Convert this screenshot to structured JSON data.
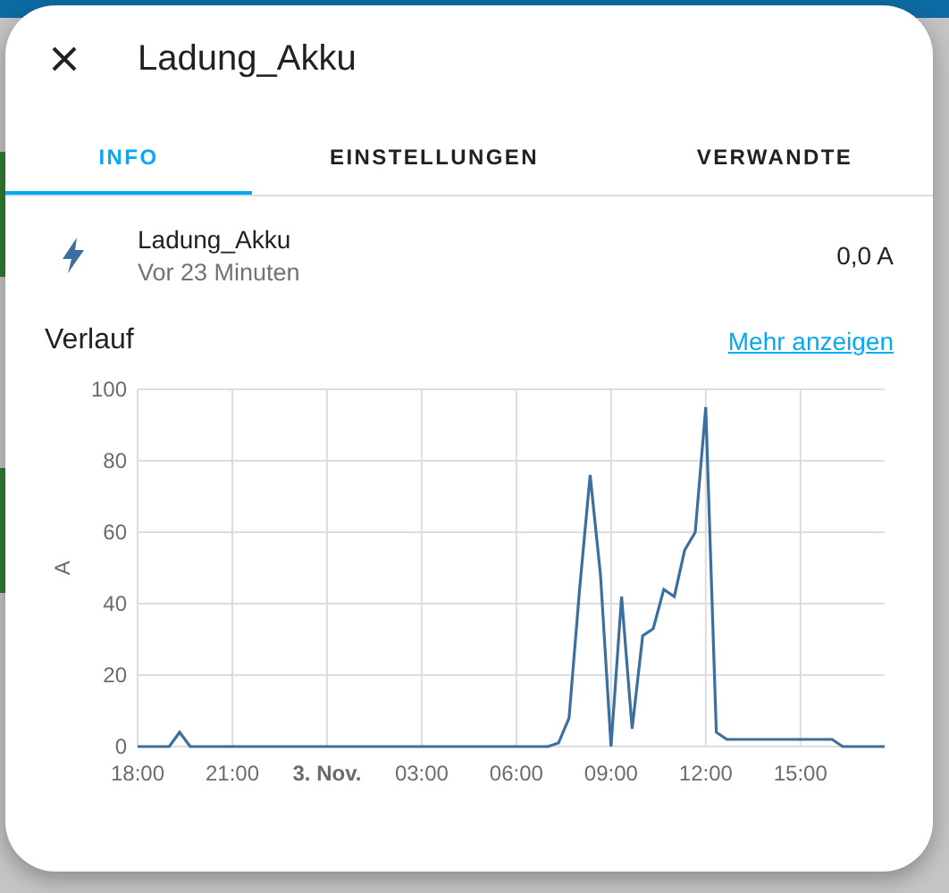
{
  "dialog": {
    "title": "Ladung_Akku"
  },
  "tabs": [
    {
      "label": "INFO",
      "selected": true
    },
    {
      "label": "EINSTELLUNGEN",
      "selected": false
    },
    {
      "label": "VERWANDTE",
      "selected": false
    }
  ],
  "entity": {
    "name": "Ladung_Akku",
    "last_changed": "Vor 23 Minuten",
    "state": "0,0 A"
  },
  "history": {
    "title": "Verlauf",
    "link": "Mehr anzeigen",
    "chart_data": {
      "type": "line",
      "ylabel": "A",
      "ylim": [
        0,
        100
      ],
      "grid": true,
      "yticks": [
        0,
        20,
        40,
        60,
        80,
        100
      ],
      "categories": [
        "18:00",
        null,
        null,
        null,
        null,
        null,
        null,
        null,
        null,
        "21:00",
        null,
        null,
        null,
        null,
        null,
        null,
        null,
        null,
        "3. Nov.",
        null,
        null,
        null,
        null,
        null,
        null,
        null,
        null,
        "03:00",
        null,
        null,
        null,
        null,
        null,
        null,
        null,
        null,
        "06:00",
        null,
        null,
        null,
        null,
        null,
        null,
        null,
        null,
        "09:00",
        null,
        null,
        null,
        null,
        null,
        null,
        null,
        null,
        "12:00",
        null,
        null,
        null,
        null,
        null,
        null,
        null,
        null,
        "15:00",
        null,
        null,
        null,
        null,
        null,
        null,
        null,
        null
      ],
      "series": [
        {
          "color": "#3b6fa0",
          "values": [
            0,
            0,
            0,
            0,
            4,
            0,
            0,
            0,
            0,
            0,
            0,
            0,
            0,
            0,
            0,
            0,
            0,
            0,
            0,
            0,
            0,
            0,
            0,
            0,
            0,
            0,
            0,
            0,
            0,
            0,
            0,
            0,
            0,
            0,
            0,
            0,
            0,
            0,
            0,
            0,
            1,
            8,
            44,
            76,
            48,
            0,
            42,
            5,
            31,
            33,
            44,
            42,
            55,
            60,
            95,
            4,
            2,
            2,
            2,
            2,
            2,
            2,
            2,
            2,
            2,
            2,
            2,
            0,
            0,
            0,
            0,
            0
          ]
        }
      ]
    }
  }
}
